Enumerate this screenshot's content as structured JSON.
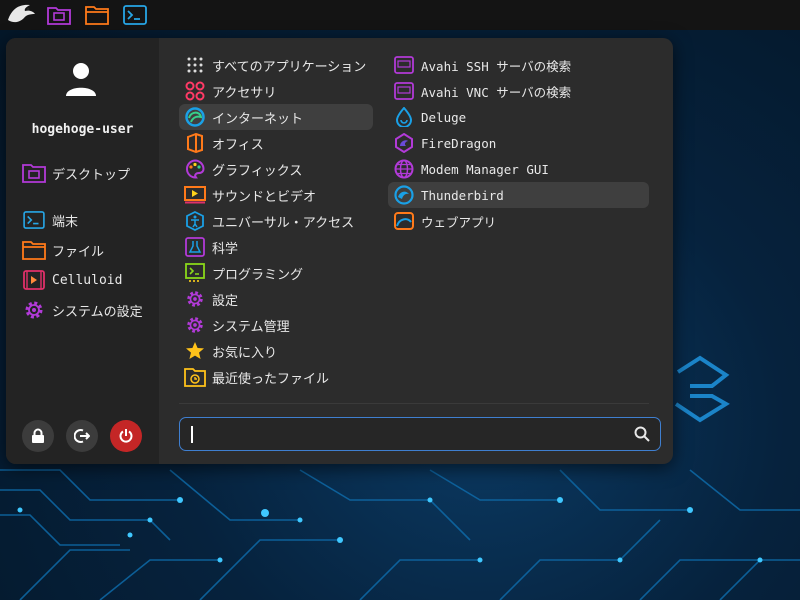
{
  "topbar": {
    "icons": [
      "eagle-logo-icon",
      "folder-monitor-icon",
      "folder-icon",
      "terminal-icon"
    ]
  },
  "user": {
    "name": "hogehoge-user"
  },
  "side": {
    "items": [
      {
        "label": "デスクトップ",
        "icon": "desktop-folder-icon"
      },
      {
        "label": "端末",
        "icon": "terminal-icon"
      },
      {
        "label": "ファイル",
        "icon": "folder-icon"
      },
      {
        "label": "Celluloid",
        "icon": "video-icon"
      },
      {
        "label": "システムの設定",
        "icon": "gear-icon"
      }
    ],
    "buttons": [
      "lock-button",
      "logout-button",
      "power-button"
    ]
  },
  "categories": [
    {
      "label": "すべてのアプリケーション",
      "icon": "grid-icon"
    },
    {
      "label": "アクセサリ",
      "icon": "accessories-icon"
    },
    {
      "label": "インターネット",
      "icon": "internet-icon",
      "active": true
    },
    {
      "label": "オフィス",
      "icon": "office-icon"
    },
    {
      "label": "グラフィックス",
      "icon": "graphics-icon"
    },
    {
      "label": "サウンドとビデオ",
      "icon": "multimedia-icon"
    },
    {
      "label": "ユニバーサル・アクセス",
      "icon": "accessibility-icon"
    },
    {
      "label": "科学",
      "icon": "science-icon"
    },
    {
      "label": "プログラミング",
      "icon": "programming-icon"
    },
    {
      "label": "設定",
      "icon": "settings-icon"
    },
    {
      "label": "システム管理",
      "icon": "system-icon"
    },
    {
      "label": "お気に入り",
      "icon": "star-icon"
    },
    {
      "label": "最近使ったファイル",
      "icon": "recent-icon"
    }
  ],
  "apps": [
    {
      "label_en": "Avahi SSH ",
      "label_jp": "サーバの検索",
      "icon": "avahi-ssh-icon"
    },
    {
      "label_en": "Avahi VNC ",
      "label_jp": "サーバの検索",
      "icon": "avahi-vnc-icon"
    },
    {
      "label_en": "Deluge",
      "label_jp": "",
      "icon": "deluge-icon"
    },
    {
      "label_en": "FireDragon",
      "label_jp": "",
      "icon": "firedragon-icon"
    },
    {
      "label_en": "Modem Manager GUI",
      "label_jp": "",
      "icon": "modem-manager-icon"
    },
    {
      "label_en": "Thunderbird",
      "label_jp": "",
      "icon": "thunderbird-icon",
      "highlight": true
    },
    {
      "label_en": "",
      "label_jp": "ウェブアプリ",
      "icon": "webapp-icon"
    }
  ],
  "search": {
    "value": "",
    "placeholder": ""
  },
  "colors": {
    "accent": "#3f7fd0",
    "power": "#c42626",
    "panel": "#2c2c2c",
    "sidepanel": "#232323",
    "wallpaper": "#06223d"
  }
}
